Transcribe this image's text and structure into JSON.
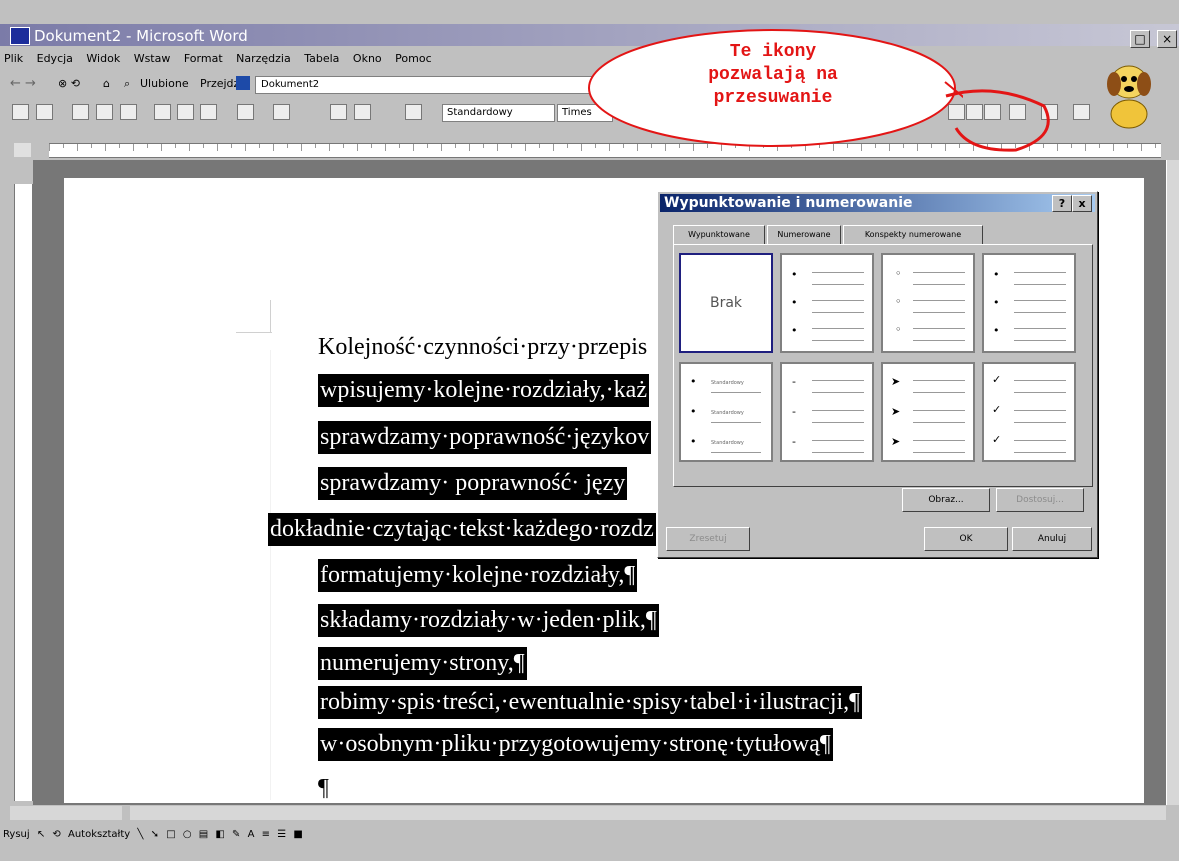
{
  "app": {
    "title": "Dokument2 - Microsoft Word"
  },
  "menu": {
    "items": [
      "Plik",
      "Edycja",
      "Widok",
      "Wstaw",
      "Format",
      "Narzędzia",
      "Tabela",
      "Okno",
      "Pomoc"
    ]
  },
  "web_toolbar": {
    "favorites_label": "Ulubione",
    "go_label": "Przejdź",
    "address_value": "Dokument2"
  },
  "standard_toolbar": {
    "style_value": "Standardowy",
    "font_value": "Times"
  },
  "callout": {
    "text_lines": [
      "Te ikony",
      "pozwalają na",
      "przesuwanie"
    ]
  },
  "document": {
    "heading_line": "Kolejność·czynności·przy·przepis",
    "lines": [
      {
        "text": "wpisujemy·kolejne·rozdziały,·każ",
        "style": "hl"
      },
      {
        "text": "sprawdzamy·poprawność·językov",
        "style": "hl"
      },
      {
        "text": "sprawdzamy· poprawność· języ",
        "style": "hl"
      },
      {
        "text": "dokładnie·czytając·tekst·każdego·rozdz",
        "style": "hl"
      },
      {
        "text": "formatujemy·kolejne·rozdziały,¶",
        "style": "hl"
      },
      {
        "text": "składamy·rozdziały·w·jeden·plik,¶",
        "style": "hl"
      },
      {
        "text": "numerujemy·strony,¶",
        "style": "hl"
      },
      {
        "text": "robimy·spis·treści,·ewentualnie·spisy·tabel·i·ilustracji,¶",
        "style": "hl"
      },
      {
        "text": "w·osobnym·pliku·przygotowujemy·stronę·tytułową¶",
        "style": "hl"
      },
      {
        "text": "¶",
        "style": "plain"
      }
    ]
  },
  "dialog": {
    "title": "Wypunktowanie i numerowanie",
    "help_label": "?",
    "close_label": "x",
    "tabs": [
      "Wypunktowane",
      "Numerowane",
      "Konspekty numerowane"
    ],
    "none_label": "Brak",
    "style_label": "Standardowy",
    "buttons": {
      "picture": "Obraz...",
      "customize": "Dostosuj...",
      "reset": "Zresetuj",
      "ok": "OK",
      "cancel": "Anuluj"
    },
    "bullet_symbols": [
      "•",
      "◦",
      "•",
      "•",
      "-",
      "➤",
      "✓"
    ]
  },
  "draw_toolbar": {
    "draw_label": "Rysuj",
    "autoshapes_label": "Autokształty"
  }
}
